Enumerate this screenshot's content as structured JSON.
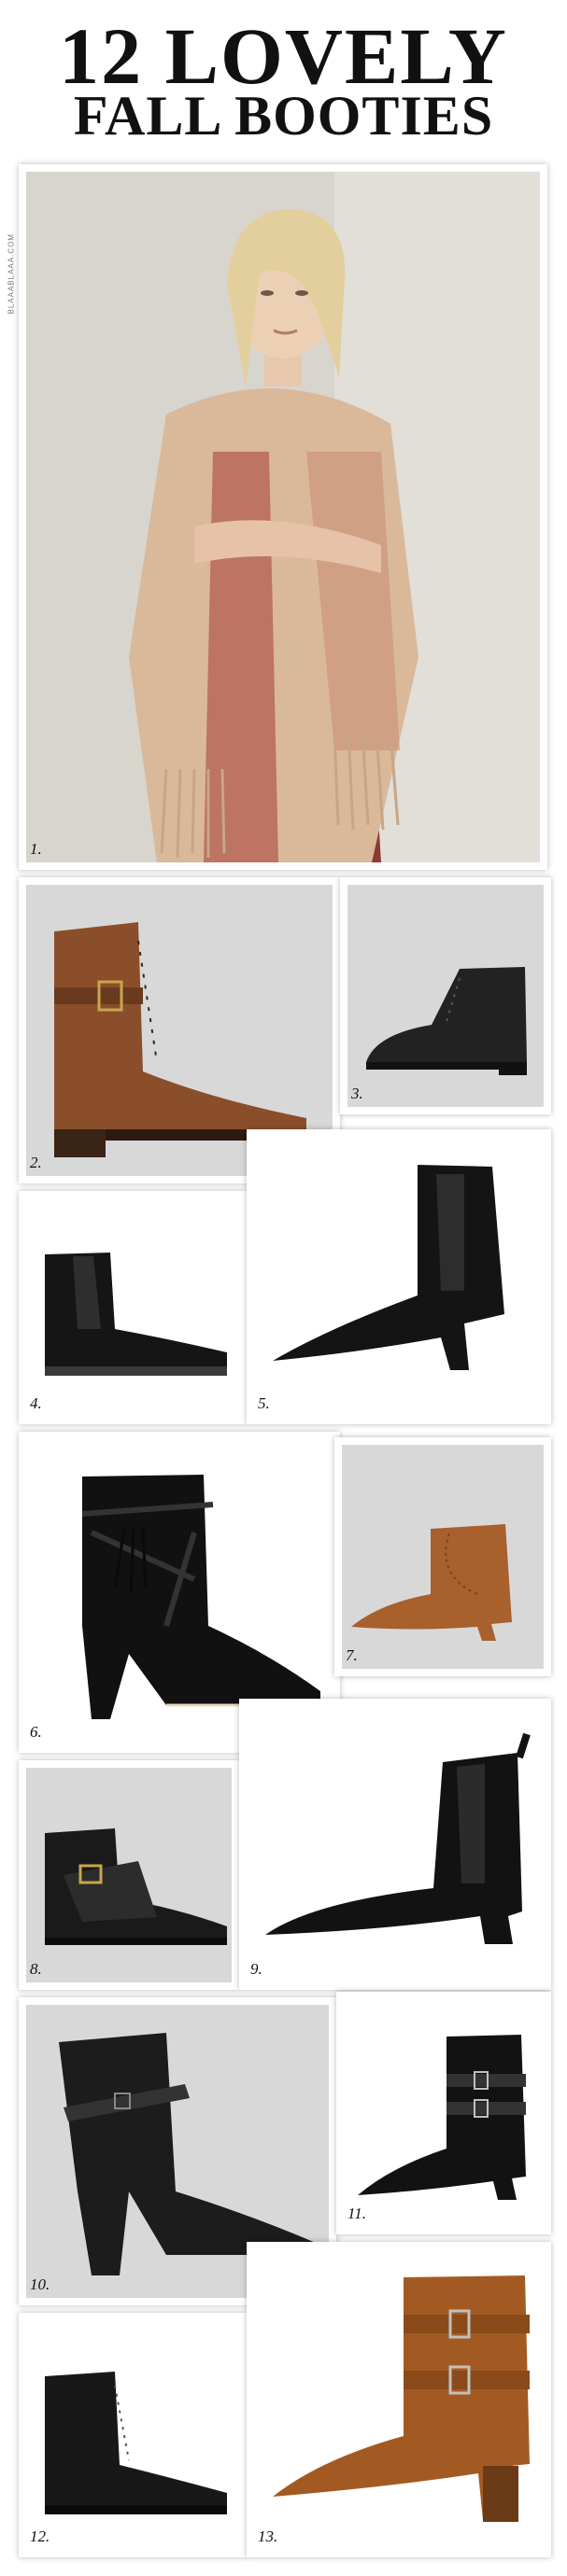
{
  "title": {
    "line1": "12 LOVELY",
    "line2": "FALL BOOTIES"
  },
  "credit": "BLAAABLAAA.COM",
  "items": [
    {
      "number": "1.",
      "subject": "model-in-scarf"
    },
    {
      "number": "2.",
      "subject": "brown-lace-up-buckle-boot"
    },
    {
      "number": "3.",
      "subject": "black-lace-up-oxford-boot"
    },
    {
      "number": "4.",
      "subject": "black-chelsea-boot"
    },
    {
      "number": "5.",
      "subject": "black-pointed-heeled-chelsea-boot"
    },
    {
      "number": "6.",
      "subject": "black-suede-tassel-heeled-boot"
    },
    {
      "number": "7.",
      "subject": "tan-suede-western-bootie"
    },
    {
      "number": "8.",
      "subject": "black-kiltie-buckle-boot"
    },
    {
      "number": "9.",
      "subject": "black-heeled-chelsea-boot"
    },
    {
      "number": "10.",
      "subject": "black-wrap-strap-heeled-boot"
    },
    {
      "number": "11.",
      "subject": "black-double-buckle-bootie"
    },
    {
      "number": "12.",
      "subject": "black-lace-up-combat-boot"
    },
    {
      "number": "13.",
      "subject": "cognac-double-buckle-heeled-boot"
    }
  ]
}
